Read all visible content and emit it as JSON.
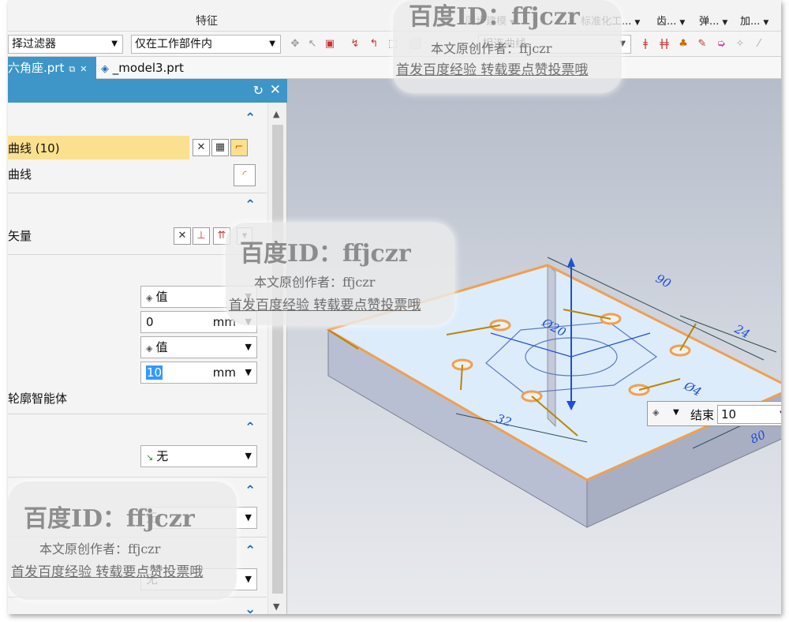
{
  "ribbon": {
    "features_label": "特征",
    "sync_modeling": "同步建模",
    "std_parts": "标准化工...",
    "gear": "齿...",
    "spring": "弹...",
    "add": "加..."
  },
  "selection_bar": {
    "filter": "择过滤器",
    "scope": "仅在工作部件内",
    "curve_rule": "相连曲线"
  },
  "tabs": {
    "active": "六角座.prt",
    "model3": "_model3.prt"
  },
  "dialog": {
    "curve_row": "曲线 (10)",
    "spline_row": "曲线",
    "vector_row": "矢量",
    "start_type": "值",
    "start_value": "0",
    "start_unit": "mm",
    "end_type": "值",
    "end_value": "10",
    "end_unit": "mm",
    "body_hint": "轮廓智能体",
    "bool_value": "无",
    "draft_value": "无",
    "offset_value": "无"
  },
  "viewport": {
    "end_label": "结束",
    "end_value": "10",
    "dims": [
      "90",
      "24",
      "32",
      "80",
      "Ø20",
      "Ø4"
    ]
  },
  "watermark": {
    "title": "百度ID：ffjczr",
    "line1": "本文原创作者：ffjczr",
    "line2": "首发百度经验 转载要点赞投票哦"
  },
  "colors": {
    "accent": "#3d96c7",
    "highlight": "#fbe08f",
    "edge": "#f0a050"
  }
}
